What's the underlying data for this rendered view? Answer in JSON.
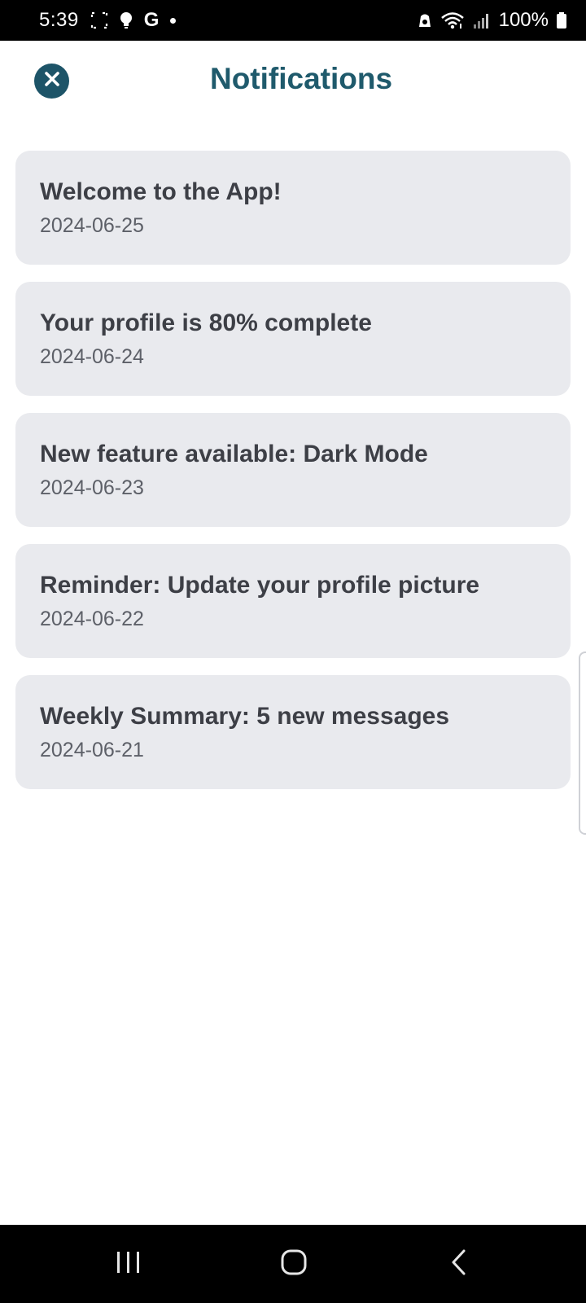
{
  "status_bar": {
    "time": "5:39",
    "g_label": "G",
    "battery": "100%",
    "icons": [
      "screenshot-frame-icon",
      "bulb-icon",
      "google-icon",
      "dot-icon",
      "alarm-lock-icon",
      "wifi-icon",
      "signal-icon",
      "battery-icon"
    ]
  },
  "header": {
    "title": "Notifications",
    "close_icon": "close-icon",
    "accent_color": "#1d5468"
  },
  "notifications": [
    {
      "title": "Welcome to the App!",
      "date": "2024-06-25"
    },
    {
      "title": "Your profile is 80% complete",
      "date": "2024-06-24"
    },
    {
      "title": "New feature available: Dark Mode",
      "date": "2024-06-23"
    },
    {
      "title": "Reminder: Update your profile picture",
      "date": "2024-06-22"
    },
    {
      "title": "Weekly Summary: 5 new messages",
      "date": "2024-06-21"
    }
  ],
  "nav_bar": {
    "buttons": [
      "recent-apps-icon",
      "home-icon",
      "back-icon"
    ]
  },
  "colors": {
    "card_bg": "#e9eaee",
    "title_text": "#3d3f46",
    "date_text": "#5d6068"
  }
}
